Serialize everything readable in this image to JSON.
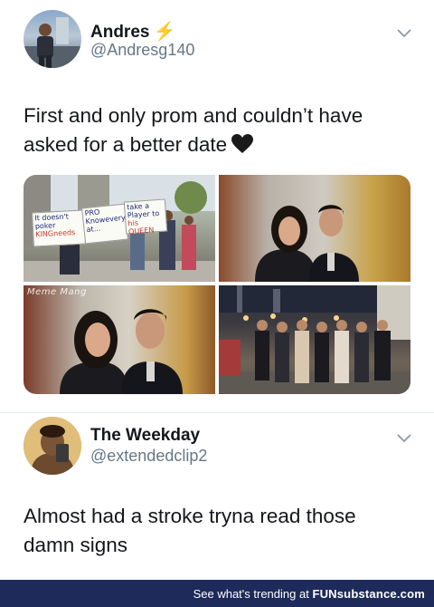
{
  "tweets": [
    {
      "name": "Andres",
      "verified_glyph": "⚡",
      "handle": "@Andresg140",
      "text": "First and only prom and couldn’t have asked for a better date",
      "photos": {
        "signs": [
          "It doesn't",
          "poker",
          "KINGneeds",
          "PRO",
          "Knowevery",
          "at...",
          "take a",
          "Player to",
          "his QUEEN"
        ],
        "watermark": "Meme Mang"
      }
    },
    {
      "name": "The Weekday",
      "handle": "@extendedclip2",
      "text": "Almost had a stroke tryna read those damn signs"
    }
  ],
  "footer": {
    "lead": "See what's trending at",
    "brand": "FUNsubstance.com"
  },
  "icons": {
    "menu": "chevron-down-icon",
    "heart": "black-heart-icon",
    "verified": "lightning-bolt-icon"
  },
  "colors": {
    "text": "#14171a",
    "handle": "#657786",
    "footer_bg": "#1e2a5a",
    "bolt": "#f2c22d"
  }
}
